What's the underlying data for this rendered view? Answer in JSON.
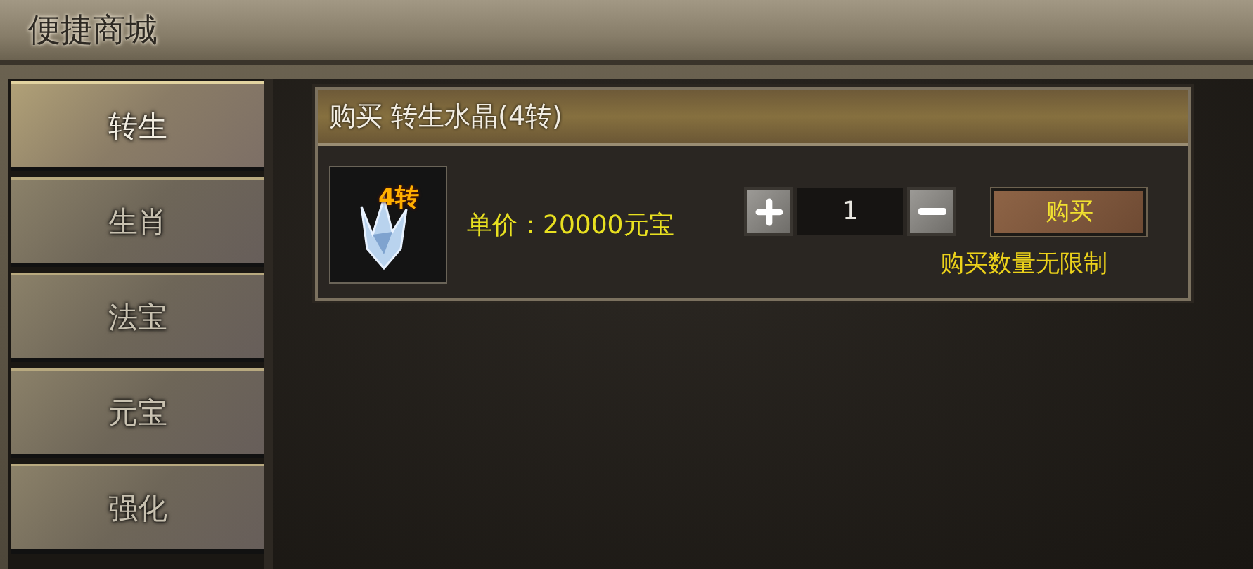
{
  "window": {
    "title": "便捷商城"
  },
  "tabs": [
    {
      "label": "转生",
      "selected": true
    },
    {
      "label": "生肖",
      "selected": false
    },
    {
      "label": "法宝",
      "selected": false
    },
    {
      "label": "元宝",
      "selected": false
    },
    {
      "label": "强化",
      "selected": false
    }
  ],
  "product": {
    "title": "购买 转生水晶(4转)",
    "badge": "4转",
    "price": "单价：20000元宝",
    "quantity": "1",
    "buy_button": "购买",
    "limit_note": "购买数量无限制"
  }
}
